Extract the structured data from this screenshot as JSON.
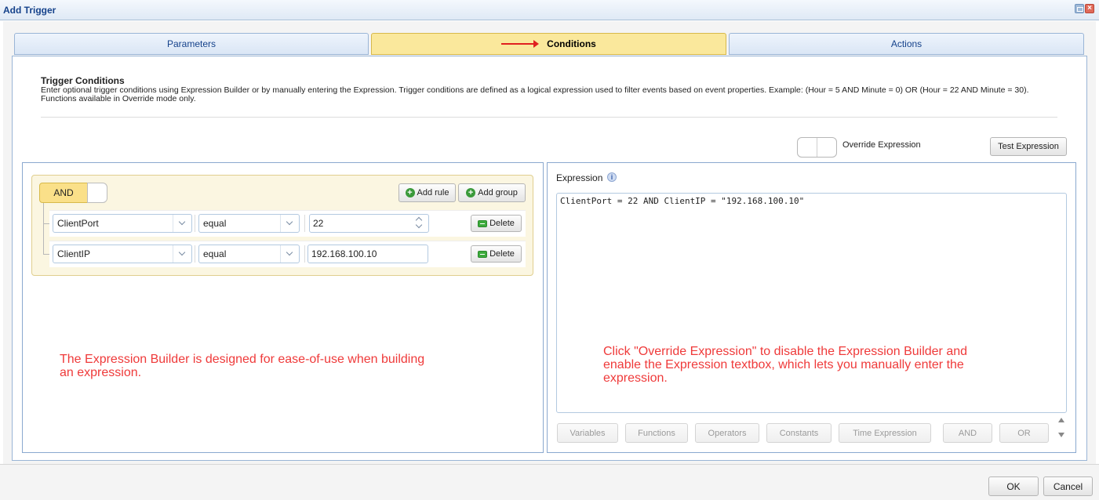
{
  "window": {
    "title": "Add Trigger"
  },
  "tabs": [
    {
      "label": "Parameters",
      "active": false
    },
    {
      "label": "Conditions",
      "active": true
    },
    {
      "label": "Actions",
      "active": false
    }
  ],
  "conditions": {
    "heading": "Trigger Conditions",
    "description": "Enter optional trigger conditions using Expression Builder or by manually entering the Expression. Trigger conditions are defined as a logical expression used to filter events based on event properties. Example: (Hour = 5 AND Minute = 0) OR (Hour = 22 AND Minute = 30).",
    "note": "Functions available in Override mode only.",
    "override_label": "Override Expression",
    "override_enabled": false,
    "test_button": "Test Expression"
  },
  "builder": {
    "group_operator": "AND",
    "add_rule": "Add rule",
    "add_group": "Add group",
    "delete_label": "Delete",
    "rules": [
      {
        "field": "ClientPort",
        "operator": "equal",
        "value": "22"
      },
      {
        "field": "ClientIP",
        "operator": "equal",
        "value": "192.168.100.10"
      }
    ],
    "annotation": "The Expression Builder is designed for ease-of-use when building an expression."
  },
  "expression": {
    "label": "Expression",
    "value": "ClientPort = 22 AND ClientIP = \"192.168.100.10\"",
    "annotation": "Click \"Override Expression\" to disable the Expression Builder and enable the Expression textbox, which lets you manually enter the expression.",
    "buttons": {
      "variables": "Variables",
      "functions": "Functions",
      "operators": "Operators",
      "constants": "Constants",
      "time_expression": "Time Expression",
      "and": "AND",
      "or": "OR"
    }
  },
  "footer": {
    "ok": "OK",
    "cancel": "Cancel"
  }
}
